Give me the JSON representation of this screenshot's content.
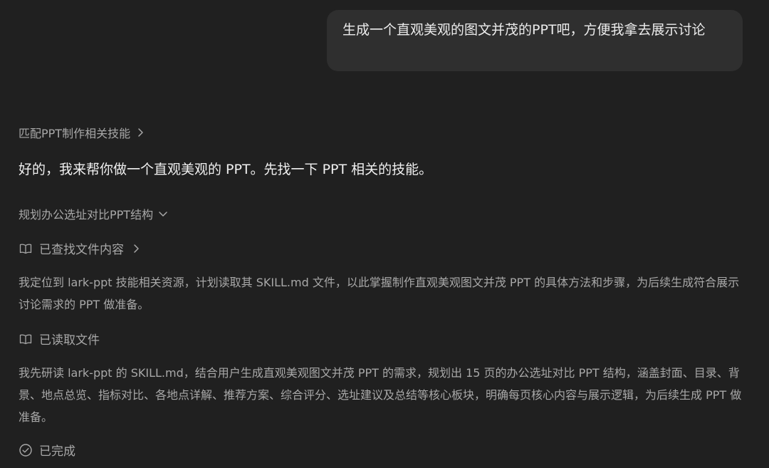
{
  "user_message": {
    "text": "生成一个直观美观的图文并茂的PPT吧，方便我拿去展示讨论"
  },
  "steps": {
    "skill_match": {
      "label": "匹配PPT制作相关技能"
    },
    "reply": {
      "text": "好的，我来帮你做一个直观美观的 PPT。先找一下 PPT 相关的技能。"
    },
    "plan": {
      "label": "规划办公选址对比PPT结构"
    },
    "search": {
      "label": "已查找文件内容"
    },
    "search_desc": {
      "text": "我定位到 lark-ppt 技能相关资源，计划读取其 SKILL.md 文件，以此掌握制作直观美观图文并茂 PPT 的具体方法和步骤，为后续生成符合展示讨论需求的 PPT 做准备。"
    },
    "read": {
      "label": "已读取文件"
    },
    "read_desc": {
      "text": "我先研读 lark-ppt 的 SKILL.md，结合用户生成直观美观图文并茂 PPT 的需求，规划出 15 页的办公选址对比 PPT 结构，涵盖封面、目录、背景、地点总览、指标对比、各地点详解、推荐方案、综合评分、选址建议及总结等核心板块，明确每页核心内容与展示逻辑，为后续生成 PPT 做准备。"
    },
    "done": {
      "label": "已完成"
    }
  },
  "colors": {
    "background": "#202020",
    "bubble": "#2f2f2f",
    "primary_text": "#ececec",
    "secondary_text": "#a8a8a8"
  },
  "icons": {
    "chevron_right": "chevron-right-icon",
    "chevron_down": "chevron-down-icon",
    "book": "book-open-icon",
    "check_circle": "check-circle-icon"
  }
}
